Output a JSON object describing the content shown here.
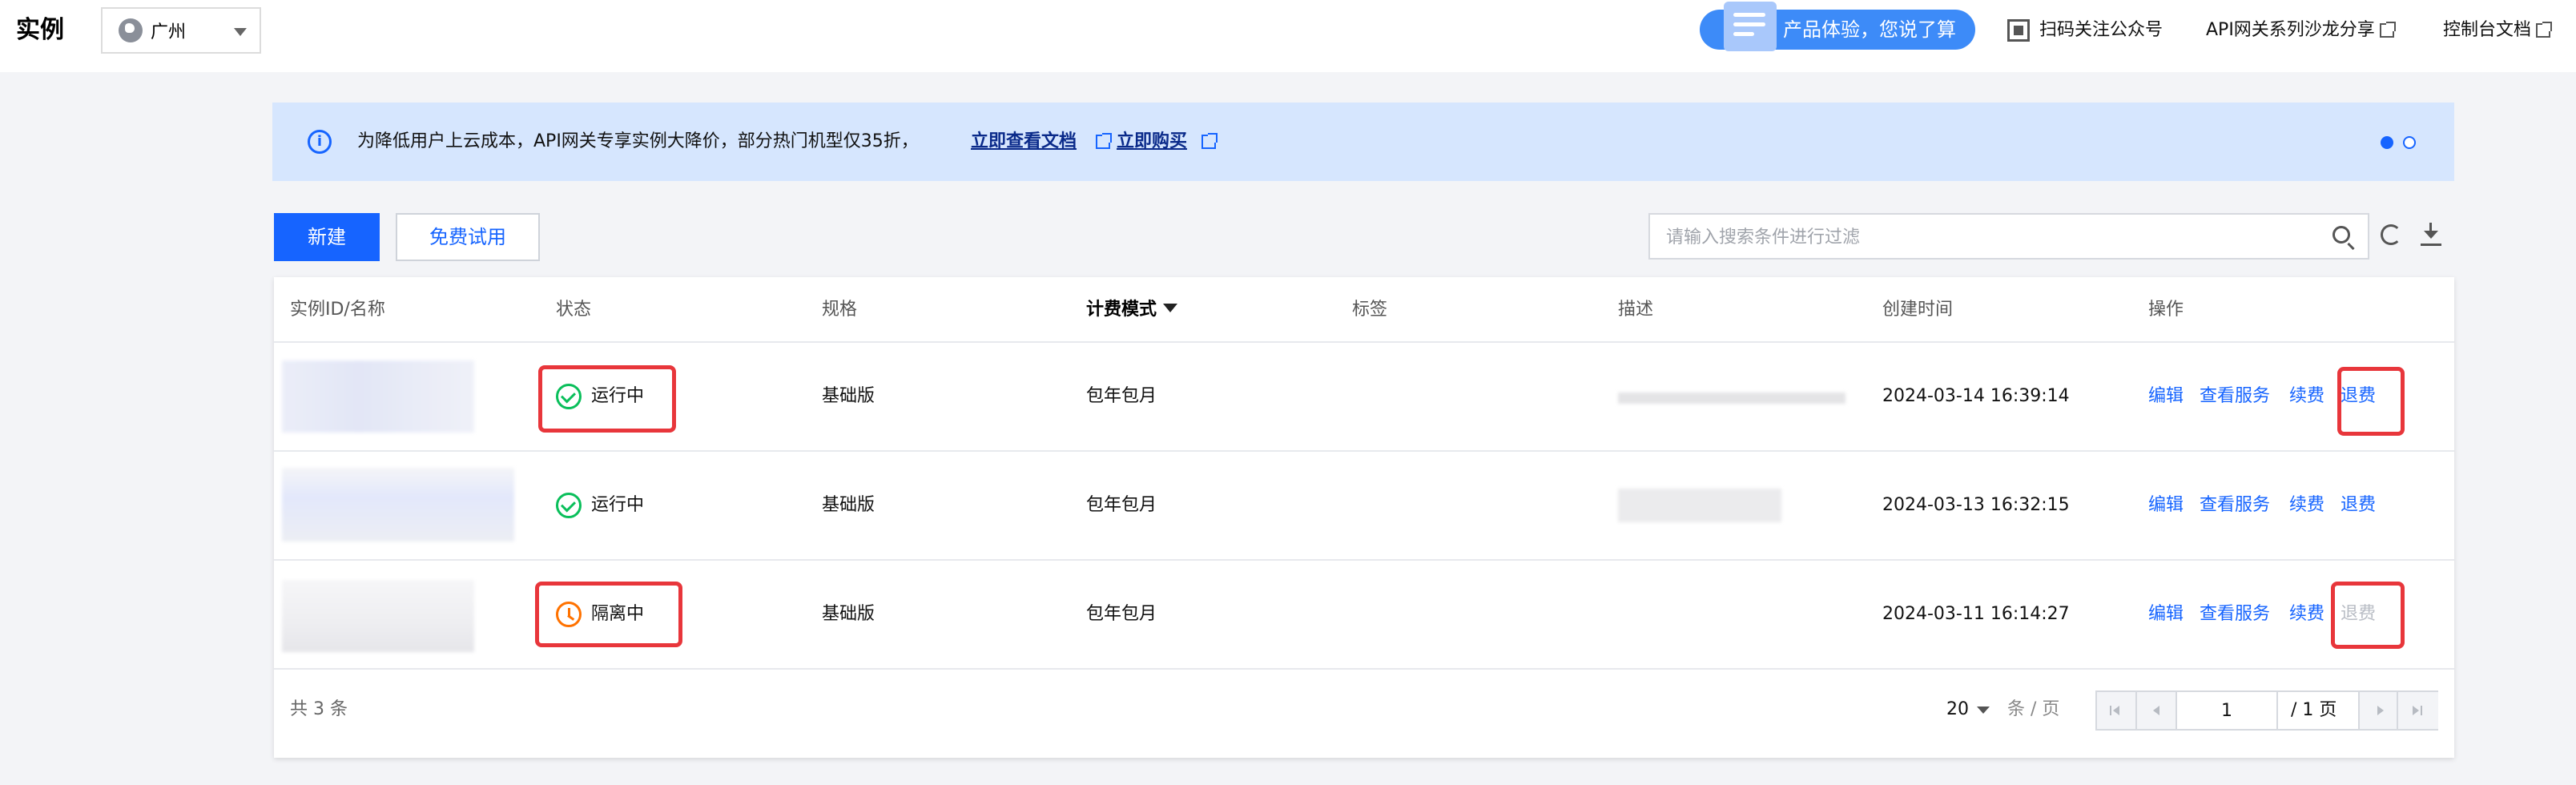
{
  "header": {
    "title": "实例",
    "region": "广州",
    "experience_button": "产品体验，您说了算",
    "links": [
      {
        "label": "扫码关注公众号"
      },
      {
        "label": "API网关系列沙龙分享"
      },
      {
        "label": "控制台文档"
      }
    ]
  },
  "banner": {
    "text": "为降低用户上云成本，API网关专享实例大降价，部分热门机型仅35折，",
    "link1": "立即查看文档",
    "link2": "立即购买"
  },
  "toolbar": {
    "new_label": "新建",
    "trial_label": "免费试用",
    "search_placeholder": "请输入搜索条件进行过滤"
  },
  "table": {
    "columns": [
      "实例ID/名称",
      "状态",
      "规格",
      "计费模式",
      "标签",
      "描述",
      "创建时间",
      "操作"
    ],
    "rows": [
      {
        "status": "运行中",
        "status_type": "running",
        "spec": "基础版",
        "billing": "包年包月",
        "created": "2024-03-14 16:39:14",
        "actions": [
          "编辑",
          "查看服务",
          "续费",
          "退费"
        ],
        "refund_disabled": false
      },
      {
        "status": "运行中",
        "status_type": "running",
        "spec": "基础版",
        "billing": "包年包月",
        "created": "2024-03-13 16:32:15",
        "actions": [
          "编辑",
          "查看服务",
          "续费",
          "退费"
        ],
        "refund_disabled": false
      },
      {
        "status": "隔离中",
        "status_type": "isolated",
        "spec": "基础版",
        "billing": "包年包月",
        "created": "2024-03-11 16:14:27",
        "actions": [
          "编辑",
          "查看服务",
          "续费",
          "退费"
        ],
        "refund_disabled": true
      }
    ]
  },
  "pagination": {
    "total": "共 3 条",
    "page_size": "20",
    "per_page_label": "条 / 页",
    "current_page": "1",
    "total_pages": "/ 1 页"
  },
  "colors": {
    "primary": "#1664ff",
    "running": "#0abf5b",
    "isolated": "#ff7200",
    "highlight": "#e8363b"
  }
}
